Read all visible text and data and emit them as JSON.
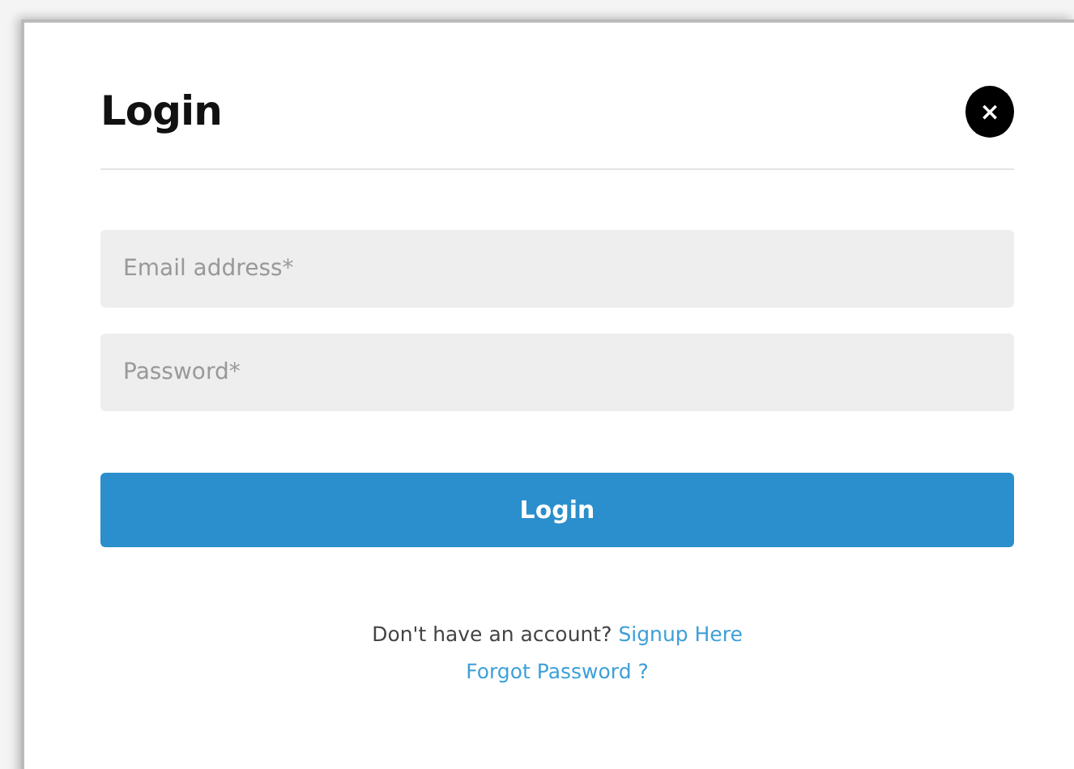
{
  "dialog": {
    "title": "Login",
    "close": "×"
  },
  "fields": [
    {
      "placeholder": "Email address*"
    },
    {
      "placeholder": "Password*"
    }
  ],
  "submit": "Login",
  "signup": {
    "prompt": "Don't have an account?",
    "link": "Signup Here"
  },
  "forgot": "Forgot Password ?"
}
